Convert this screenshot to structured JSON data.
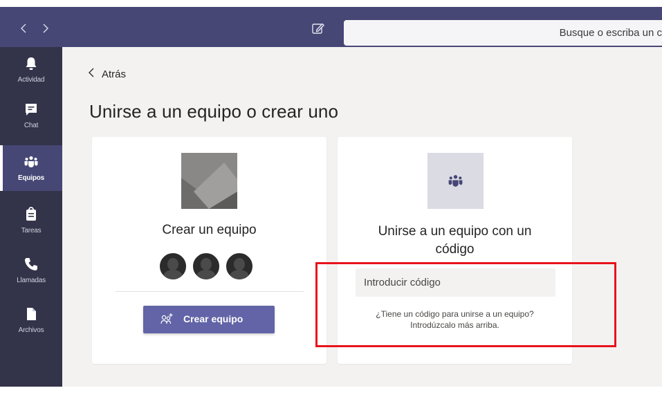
{
  "header": {
    "back_glyph": "〈",
    "forward_glyph": "〉",
    "search_placeholder": "Busque o escriba un c"
  },
  "rail": {
    "items": [
      {
        "label": "Actividad",
        "icon": "bell-icon"
      },
      {
        "label": "Chat",
        "icon": "chat-icon"
      },
      {
        "label": "Equipos",
        "icon": "teams-icon",
        "active": true
      },
      {
        "label": "Tareas",
        "icon": "tasks-icon"
      },
      {
        "label": "Llamadas",
        "icon": "phone-icon"
      },
      {
        "label": "Archivos",
        "icon": "file-icon"
      }
    ],
    "more": "more-icon"
  },
  "main": {
    "back_label": "Atrás",
    "title": "Unirse a un equipo o crear uno",
    "create_card": {
      "title": "Crear un equipo",
      "button_label": "Crear equipo"
    },
    "join_card": {
      "title_line1": "Unirse a un equipo con un",
      "title_line2": "código",
      "input_placeholder": "Introducir código",
      "help_line1": "¿Tiene un código para unirse a un equipo?",
      "help_line2": "Introdúzcalo más arriba."
    }
  },
  "colors": {
    "titlebar": "#464775",
    "rail": "#33344a",
    "accent": "#6264a7",
    "highlight": "#e8131c",
    "canvas": "#f3f2f1"
  }
}
